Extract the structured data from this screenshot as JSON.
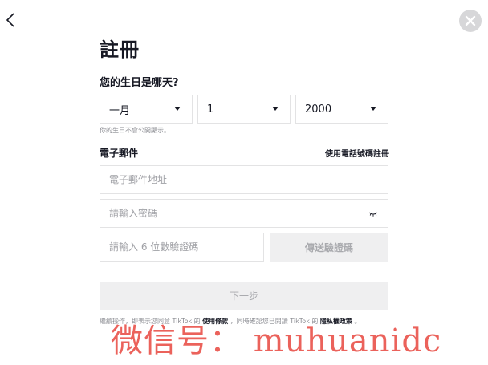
{
  "header": {
    "back_icon": "chevron-left-icon",
    "close_icon": "close-icon"
  },
  "title": "註冊",
  "dob": {
    "label": "您的生日是哪天?",
    "month": "一月",
    "day": "1",
    "year": "2000",
    "hint": "你的生日不會公開顯示。"
  },
  "email": {
    "label": "電子郵件",
    "phone_link": "使用電話號碼註冊",
    "email_placeholder": "電子郵件地址",
    "password_placeholder": "請輸入密碼",
    "code_placeholder": "請輸入 6 位數驗證碼",
    "send_code": "傳送驗證碼"
  },
  "next_label": "下一步",
  "terms": {
    "prefix": "繼續操作，即表示您同意 TikTok 的",
    "terms_link": "使用條款",
    "middle": "，同時確認您已閱讀 TikTok 的",
    "privacy_link": "隱私權政策",
    "suffix": "。"
  },
  "watermark": "微信号： muhuanidc",
  "colors": {
    "close_bg": "#d7d7d9",
    "disabled_bg": "#efeff0",
    "disabled_text": "#a9aaae",
    "border": "#e3e3e4",
    "watermark": "#e8463e"
  }
}
